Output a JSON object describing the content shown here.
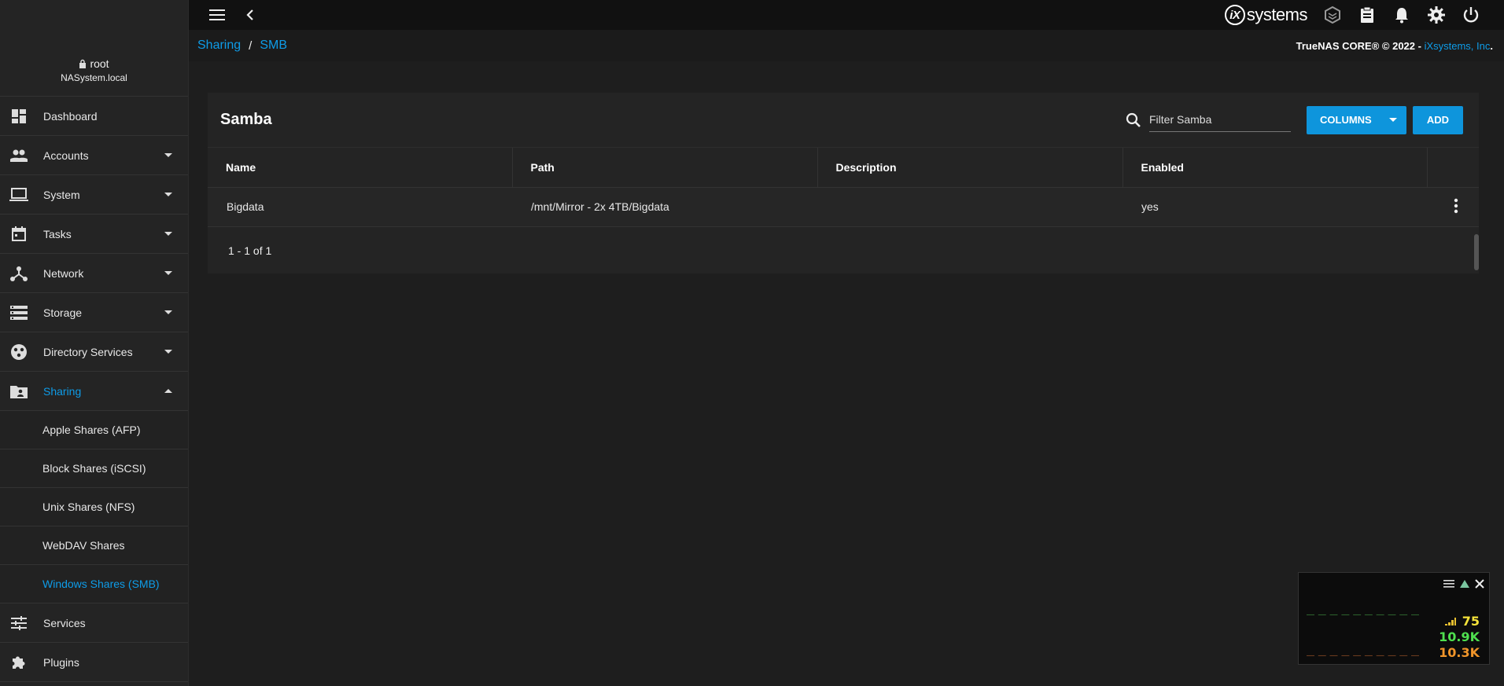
{
  "sidebar": {
    "user": "root",
    "host": "NASystem.local",
    "items": [
      {
        "label": "Dashboard",
        "icon": "dashboard-icon",
        "expandable": false
      },
      {
        "label": "Accounts",
        "icon": "people-icon",
        "expandable": true
      },
      {
        "label": "System",
        "icon": "laptop-icon",
        "expandable": true
      },
      {
        "label": "Tasks",
        "icon": "calendar-icon",
        "expandable": true
      },
      {
        "label": "Network",
        "icon": "network-icon",
        "expandable": true
      },
      {
        "label": "Storage",
        "icon": "storage-icon",
        "expandable": true
      },
      {
        "label": "Directory Services",
        "icon": "directory-icon",
        "expandable": true
      },
      {
        "label": "Sharing",
        "icon": "folder-shared-icon",
        "expandable": true,
        "expanded": true
      }
    ],
    "sharing_subitems": [
      {
        "label": "Apple Shares (AFP)"
      },
      {
        "label": "Block Shares (iSCSI)"
      },
      {
        "label": "Unix Shares (NFS)"
      },
      {
        "label": "WebDAV Shares"
      },
      {
        "label": "Windows Shares (SMB)",
        "active": true
      }
    ],
    "bottom_items": [
      {
        "label": "Services",
        "icon": "tune-icon"
      },
      {
        "label": "Plugins",
        "icon": "puzzle-icon"
      }
    ]
  },
  "topbar": {
    "brand_mark": "iX",
    "brand_text": "systems"
  },
  "breadcrumb": {
    "items": [
      "Sharing",
      "SMB"
    ],
    "separator": "/",
    "copyright": "TrueNAS CORE® © 2022 - ",
    "copyright_link": "iXsystems, Inc",
    "copyright_end": "."
  },
  "card": {
    "title": "Samba",
    "filter_placeholder": "Filter Samba",
    "columns_label": "COLUMNS",
    "add_label": "ADD",
    "headers": [
      "Name",
      "Path",
      "Description",
      "Enabled"
    ],
    "rows": [
      {
        "name": "Bigdata",
        "path": "/mnt/Mirror - 2x 4TB/Bigdata",
        "description": "",
        "enabled": "yes"
      }
    ],
    "pager": "1 - 1 of 1"
  },
  "widget": {
    "v1": "75",
    "v2": "10.9K",
    "v3": "10.3K"
  },
  "colors": {
    "accent": "#0e9ce8",
    "button": "#0e95dc",
    "v1": "#f5e23a",
    "v2": "#4fe04f",
    "v3": "#f0952a"
  }
}
